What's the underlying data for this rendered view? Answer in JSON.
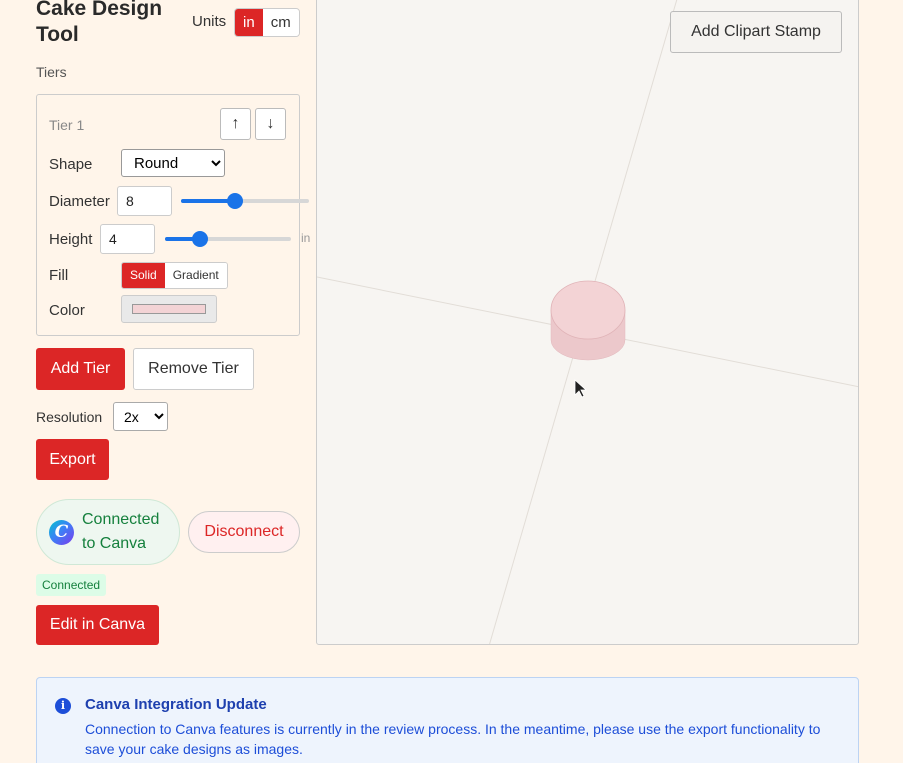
{
  "app": {
    "title": "Cake Design Tool"
  },
  "units": {
    "label": "Units",
    "options": [
      "in",
      "cm"
    ],
    "selected": "in"
  },
  "tiers": {
    "section_label": "Tiers",
    "items": [
      {
        "title": "Tier 1",
        "move_up_icon": "arrow-up-icon",
        "move_down_icon": "arrow-down-icon",
        "shape_label": "Shape",
        "shape_value": "Round",
        "diameter_label": "Diameter",
        "diameter_value": "8",
        "diameter_slider_fraction": 0.42,
        "height_label": "Height",
        "height_value": "4",
        "height_slider_fraction": 0.28,
        "height_unit": "in",
        "fill_label": "Fill",
        "fill_options": [
          "Solid",
          "Gradient"
        ],
        "fill_selected": "Solid",
        "color_label": "Color",
        "color_value": "#f3d3d5"
      }
    ]
  },
  "actions": {
    "add_tier": "Add Tier",
    "remove_tier": "Remove Tier",
    "export": "Export"
  },
  "resolution": {
    "label": "Resolution",
    "value": "2x"
  },
  "canva": {
    "status_line1": "Connected",
    "status_line2": "to Canva",
    "disconnect": "Disconnect",
    "badge": "Connected",
    "edit": "Edit in Canva"
  },
  "canvas": {
    "stamp_button": "Add Clipart Stamp"
  },
  "notice": {
    "icon": "info-icon",
    "title": "Canva Integration Update",
    "text": "Connection to Canva features is currently in the review process. In the meantime, please use the export functionality to save your cake designs as images."
  },
  "colors": {
    "accent": "#dc2626",
    "cake": "#f3d3d5",
    "info": "#1d4ed8",
    "success": "#15803d"
  }
}
